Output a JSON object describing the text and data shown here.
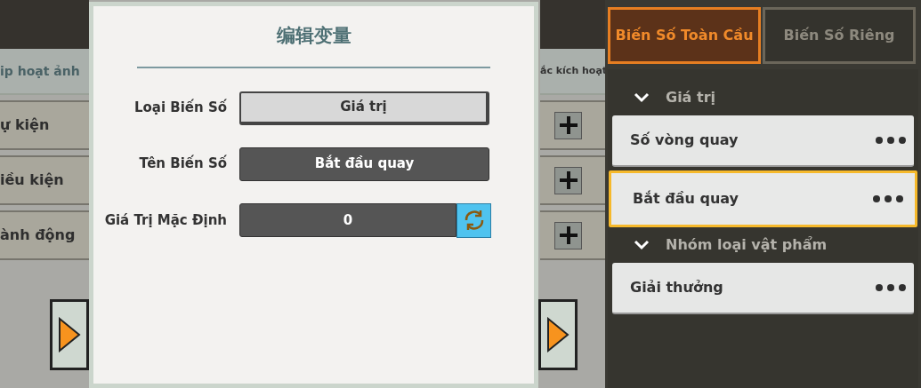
{
  "background": {
    "left_header": "ip hoạt ảnh",
    "right_header": "ắc kích hoạt",
    "rows": [
      {
        "label": "ự kiện"
      },
      {
        "label": "iều kiện"
      },
      {
        "label": "ành động"
      }
    ]
  },
  "dialog": {
    "title": "编辑变量",
    "fields": [
      {
        "kind": "select",
        "label": "Loại Biến Số",
        "value": "Giá trị"
      },
      {
        "kind": "text",
        "label": "Tên Biến Số",
        "value": "Bắt đầu quay"
      },
      {
        "kind": "reset",
        "label": "Giá Trị Mặc Định",
        "value": "0"
      }
    ]
  },
  "panel": {
    "tabs": [
      {
        "label": "Biến Số Toàn Cầu",
        "selected": true
      },
      {
        "label": "Biến Số Riêng",
        "selected": false
      }
    ],
    "groups": [
      {
        "label": "Giá trị",
        "expanded": true,
        "items": [
          {
            "name": "Số vòng quay",
            "selected": false
          },
          {
            "name": "Bắt đầu quay",
            "selected": true
          }
        ]
      },
      {
        "label": "Nhóm loại vật phẩm",
        "expanded": true,
        "items": [
          {
            "name": "Giải thưởng",
            "selected": false
          }
        ]
      }
    ]
  }
}
